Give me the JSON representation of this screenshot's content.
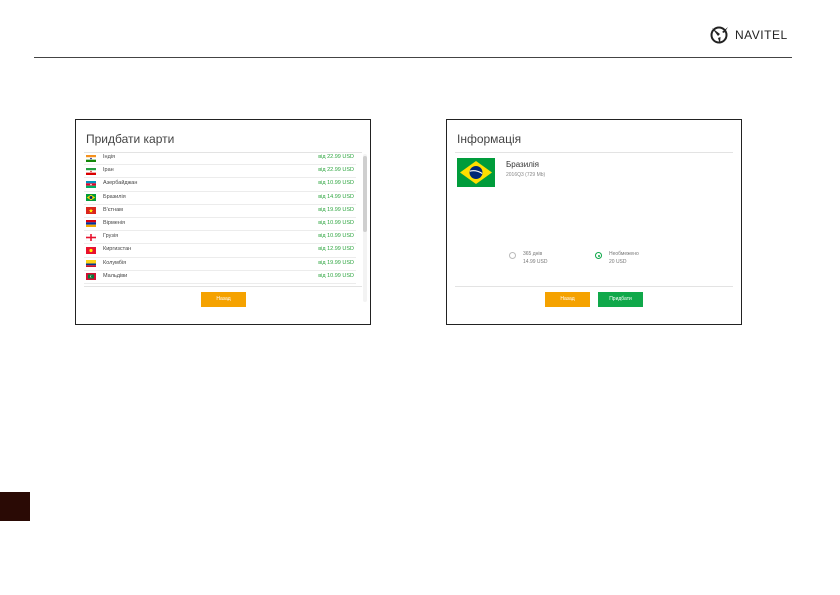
{
  "brand": {
    "name": "NAVITEL"
  },
  "buy_maps": {
    "title": "Придбати карти",
    "items": [
      {
        "name": "Індія",
        "price": "від 22.99 USD",
        "flag": "india-flag"
      },
      {
        "name": "Іран",
        "price": "від 22.99 USD",
        "flag": "iran-flag"
      },
      {
        "name": "Азербайджан",
        "price": "від 10.99 USD",
        "flag": "azerbaijan-flag"
      },
      {
        "name": "Бразилія",
        "price": "від 14.99 USD",
        "flag": "brazil-flag"
      },
      {
        "name": "В'єтнам",
        "price": "від 19.99 USD",
        "flag": "vietnam-flag"
      },
      {
        "name": "Вірменія",
        "price": "від 10.99 USD",
        "flag": "armenia-flag"
      },
      {
        "name": "Грузія",
        "price": "від 10.99 USD",
        "flag": "georgia-flag"
      },
      {
        "name": "Киргизстан",
        "price": "від 12.99 USD",
        "flag": "kyrgyzstan-flag"
      },
      {
        "name": "Колумбія",
        "price": "від 19.99 USD",
        "flag": "colombia-flag"
      },
      {
        "name": "Мальдіви",
        "price": "від 10.99 USD",
        "flag": "maldives-flag"
      }
    ],
    "back_label": "Назад"
  },
  "info": {
    "title": "Інформація",
    "country": "Бразилія",
    "meta": "2016Q3 (729 Mb)",
    "options": [
      {
        "label": "365 днів",
        "price": "14.99 USD",
        "selected": false
      },
      {
        "label": "Необмежено",
        "price": "20 USD",
        "selected": true
      }
    ],
    "back_label": "Назад",
    "buy_label": "Придбати"
  },
  "colors": {
    "accent_orange": "#f5a200",
    "accent_green": "#10a84a",
    "price_green": "#2da53f",
    "page_tab": "#2a0a05"
  }
}
